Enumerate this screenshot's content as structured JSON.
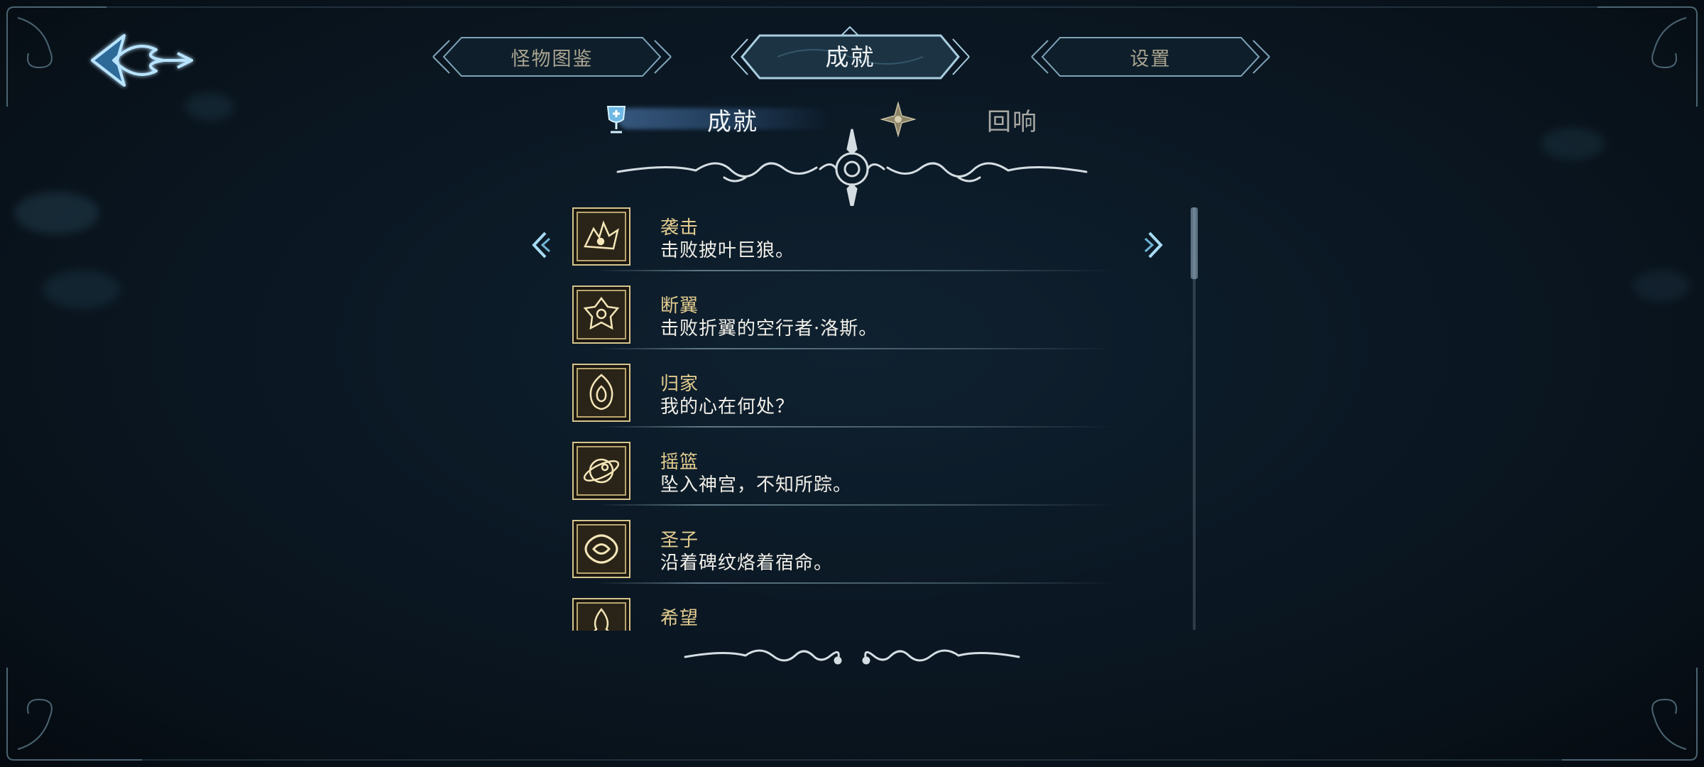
{
  "top_tabs": [
    {
      "label": "怪物图鉴",
      "active": false
    },
    {
      "label": "成就",
      "active": true
    },
    {
      "label": "设置",
      "active": false
    }
  ],
  "sub_tabs": [
    {
      "label": "成就",
      "icon": "trophy-icon",
      "active": true
    },
    {
      "label": "回响",
      "icon": "star-emblem-icon",
      "active": false
    }
  ],
  "achievements": [
    {
      "title": "袭击",
      "desc": "击败披叶巨狼。",
      "icon": "wolf-emblem-icon"
    },
    {
      "title": "断翼",
      "desc": "击败折翼的空行者·洛斯。",
      "icon": "winged-emblem-icon"
    },
    {
      "title": "归家",
      "desc": "我的心在何处？",
      "icon": "flame-heart-icon"
    },
    {
      "title": "摇篮",
      "desc": "坠入神宫，不知所踪。",
      "icon": "orb-icon"
    },
    {
      "title": "圣子",
      "desc": "沿着碑纹烙着宿命。",
      "icon": "knot-icon"
    },
    {
      "title": "希望",
      "desc": "",
      "icon": "ember-icon"
    }
  ],
  "scroll": {
    "position": 0.0,
    "visible_fraction": 0.17
  },
  "colors": {
    "background": "#0b1824",
    "accent_blue": "#9fd6ff",
    "gold_title": "#e3cc8f",
    "desc_text": "#f1efe8",
    "tab_inactive": "#a9a48f"
  }
}
